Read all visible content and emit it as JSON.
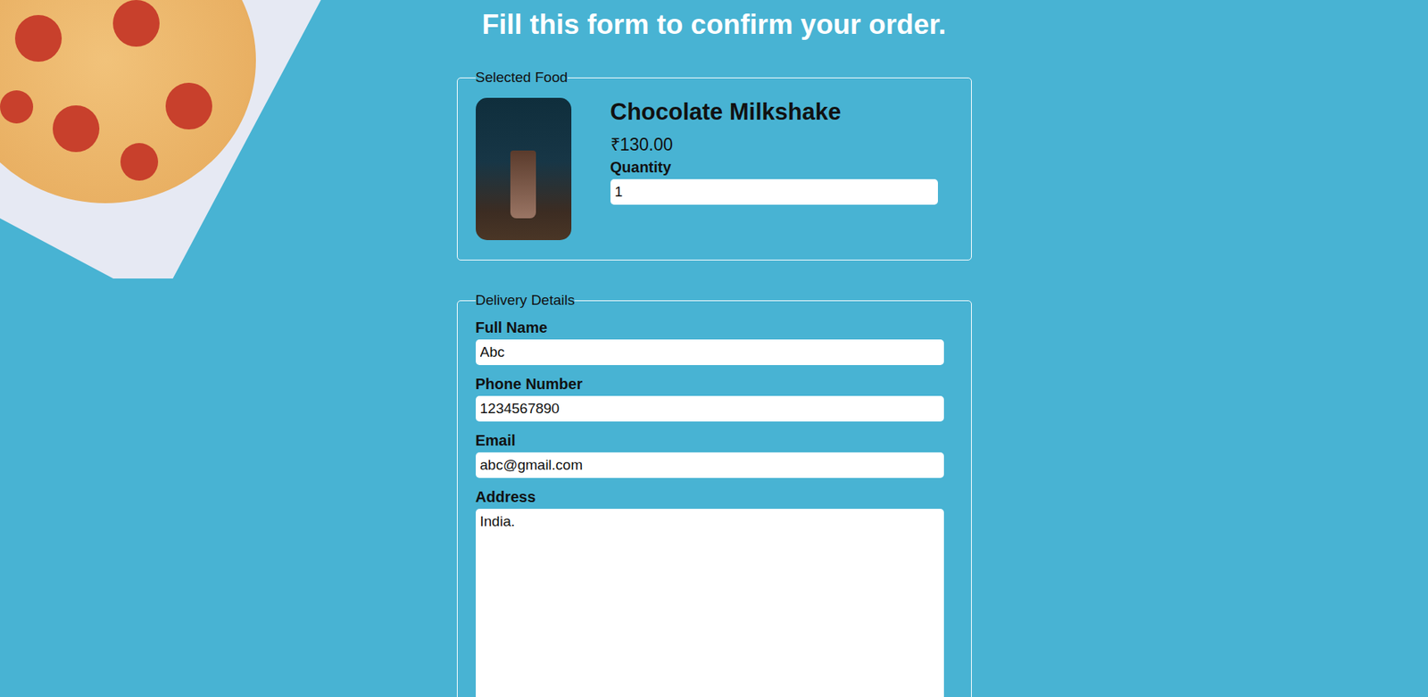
{
  "page": {
    "title": "Fill this form to confirm your order."
  },
  "selected_food": {
    "legend": "Selected Food",
    "name": "Chocolate Milkshake",
    "price": "₹130.00",
    "quantity_label": "Quantity",
    "quantity": "1"
  },
  "delivery": {
    "legend": "Delivery Details",
    "fields": [
      {
        "label": "Full Name",
        "value": "Abc",
        "kind": "input"
      },
      {
        "label": "Phone Number",
        "value": "1234567890",
        "kind": "input"
      },
      {
        "label": "Email",
        "value": "abc@gmail.com",
        "kind": "input"
      },
      {
        "label": "Address",
        "value": "India.",
        "kind": "textarea"
      }
    ]
  }
}
